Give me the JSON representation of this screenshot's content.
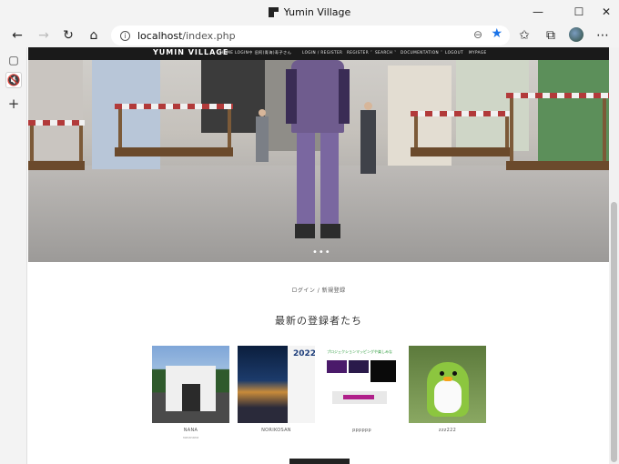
{
  "window": {
    "title": "Yumin Village",
    "minimize_glyph": "—",
    "maximize_glyph": "☐",
    "close_glyph": "✕"
  },
  "browser": {
    "url_host": "localhost",
    "url_path": "/index.php",
    "icons": {
      "back": "←",
      "forward": "→",
      "refresh": "↻",
      "home": "⌂",
      "info": "i",
      "zoom": "⊖",
      "favorite": "★",
      "favorites_bar": "✩",
      "collections": "⧉",
      "more": "⋯"
    }
  },
  "sidebar": {
    "tabs_icon": "▢",
    "mute_icon": "🔇",
    "add_icon": "+"
  },
  "site": {
    "brand": "YUMIN VILLAGE",
    "nav": [
      "HOME LOGIN中 旧阿(青海)寿子さん",
      "LOGIN / REGISTER",
      "REGISTER ˅",
      "SEARCH ˅",
      "DOCUMENTATION ˅",
      "LOGOUT",
      "MYPAGE"
    ],
    "slider_dots": "•••"
  },
  "main": {
    "login_link": "ログイン / 新規登録",
    "section_title": "最新の登録者たち",
    "members": [
      {
        "name": "NANA",
        "sub": "nananana"
      },
      {
        "name": "NORIKOSAN",
        "sub": ""
      },
      {
        "name": "pppppp",
        "sub": ""
      },
      {
        "name": "zzz222",
        "sub": ""
      }
    ],
    "poster_year": "2022",
    "poster_title": "プロジェクションマッピングや楽しみな"
  }
}
